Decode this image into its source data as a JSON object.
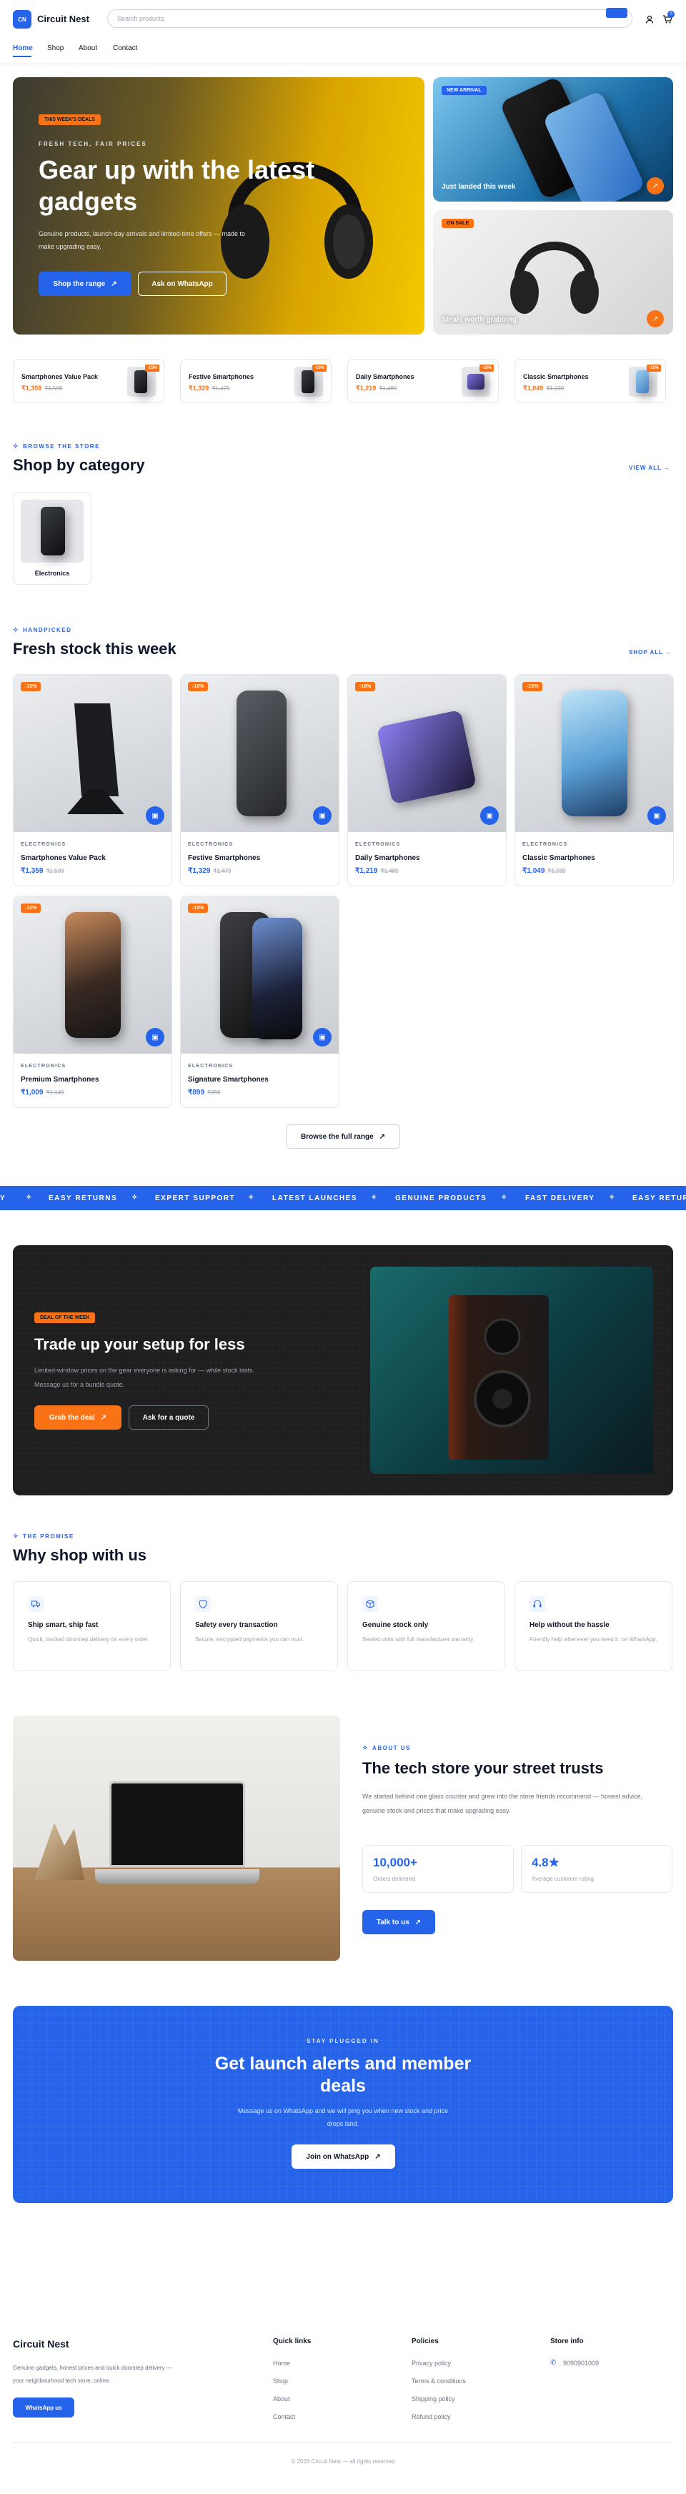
{
  "brand": {
    "name": "Circuit Nest",
    "logo_letter": "CN"
  },
  "search": {
    "placeholder": "Search products"
  },
  "header": {
    "cart_count": "0"
  },
  "nav": [
    "Home",
    "Shop",
    "About",
    "Contact"
  ],
  "hero": {
    "badge": "THIS WEEK'S DEALS",
    "eyebrow": "FRESH TECH, FAIR PRICES",
    "title": "Gear up with the latest gadgets",
    "subtitle": "Genuine products, launch-day arrivals and limited-time offers — made to make upgrading easy.",
    "primary": "Shop the range",
    "secondary": "Ask on WhatsApp"
  },
  "side_promos": [
    {
      "badge": "NEW ARRIVAL",
      "caption": "Just landed this week"
    },
    {
      "badge": "ON SALE",
      "caption": "Steals worth grabbing"
    }
  ],
  "mini_products": [
    {
      "name": "Smartphones Value Pack",
      "price": "₹1,359",
      "old": "₹1,599",
      "badge": "-15%"
    },
    {
      "name": "Festive Smartphones",
      "price": "₹1,329",
      "old": "₹1,479",
      "badge": "-10%"
    },
    {
      "name": "Daily Smartphones",
      "price": "₹1,219",
      "old": "₹1,489",
      "badge": "-18%"
    },
    {
      "name": "Classic Smartphones",
      "price": "₹1,049",
      "old": "₹1,239",
      "badge": "-15%"
    }
  ],
  "categories": {
    "eyebrow": "BROWSE THE STORE",
    "title": "Shop by category",
    "view_all": "VIEW ALL",
    "items": [
      "Electronics"
    ]
  },
  "fresh": {
    "eyebrow": "HANDPICKED",
    "title": "Fresh stock this week",
    "shop_all": "SHOP ALL",
    "browse": "Browse the full range"
  },
  "products": [
    {
      "category": "ELECTRONICS",
      "name": "Smartphones Value Pack",
      "price": "₹1,359",
      "old": "₹1,599",
      "badge": "-15%"
    },
    {
      "category": "ELECTRONICS",
      "name": "Festive Smartphones",
      "price": "₹1,329",
      "old": "₹1,479",
      "badge": "-10%"
    },
    {
      "category": "ELECTRONICS",
      "name": "Daily Smartphones",
      "price": "₹1,219",
      "old": "₹1,489",
      "badge": "-18%"
    },
    {
      "category": "ELECTRONICS",
      "name": "Classic Smartphones",
      "price": "₹1,049",
      "old": "₹1,239",
      "badge": "-15%"
    },
    {
      "category": "ELECTRONICS",
      "name": "Premium Smartphones",
      "price": "₹1,009",
      "old": "₹1,149",
      "badge": "-12%"
    },
    {
      "category": "ELECTRONICS",
      "name": "Signature Smartphones",
      "price": "₹899",
      "old": "₹999",
      "badge": "-10%"
    }
  ],
  "ticker": [
    "Y",
    "EASY RETURNS",
    "EXPERT SUPPORT",
    "LATEST LAUNCHES",
    "GENUINE PRODUCTS",
    "FAST DELIVERY",
    "EASY RETUR"
  ],
  "deal": {
    "badge": "DEAL OF THE WEEK",
    "title": "Trade up your setup for less",
    "text": "Limited-window prices on the gear everyone is asking for — while stock lasts. Message us for a bundle quote.",
    "primary": "Grab the deal",
    "secondary": "Ask for a quote"
  },
  "promise": {
    "eyebrow": "THE PROMISE",
    "title": "Why shop with us",
    "items": [
      {
        "title": "Ship smart, ship fast",
        "text": "Quick, tracked doorstep delivery on every order."
      },
      {
        "title": "Safety every transaction",
        "text": "Secure, encrypted payments you can trust."
      },
      {
        "title": "Genuine stock only",
        "text": "Sealed units with full manufacturer warranty."
      },
      {
        "title": "Help without the hassle",
        "text": "Friendly help whenever you need it, on WhatsApp."
      }
    ]
  },
  "about": {
    "eyebrow": "ABOUT US",
    "title": "The tech store your street trusts",
    "text": "We started behind one glass counter and grew into the store friends recommend — honest advice, genuine stock and prices that make upgrading easy.",
    "stats": [
      {
        "value": "10,000+",
        "label": "Orders delivered"
      },
      {
        "value": "4.8★",
        "label": "Average customer rating"
      }
    ],
    "cta": "Talk to us"
  },
  "newsletter": {
    "eyebrow": "STAY PLUGGED IN",
    "title": "Get launch alerts and member deals",
    "text": "Message us on WhatsApp and we will ping you when new stock and price drops land.",
    "cta": "Join on WhatsApp"
  },
  "footer": {
    "brand": "Circuit Nest",
    "text": "Genuine gadgets, honest prices and quick doorstep delivery — your neighbourhood tech store, online.",
    "whatsapp": "WhatsApp us",
    "quick_title": "Quick links",
    "quick": [
      "Home",
      "Shop",
      "About",
      "Contact"
    ],
    "policies_title": "Policies",
    "policies": [
      "Privacy policy",
      "Terms & conditions",
      "Shipping policy",
      "Refund policy"
    ],
    "store_title": "Store info",
    "phone": "9090901009",
    "copyright": "© 2026 Circuit Nest — all rights reserved"
  },
  "colors": {
    "brand": "#2563eb",
    "accent": "#f97316",
    "dark": "#1f1f1f"
  }
}
